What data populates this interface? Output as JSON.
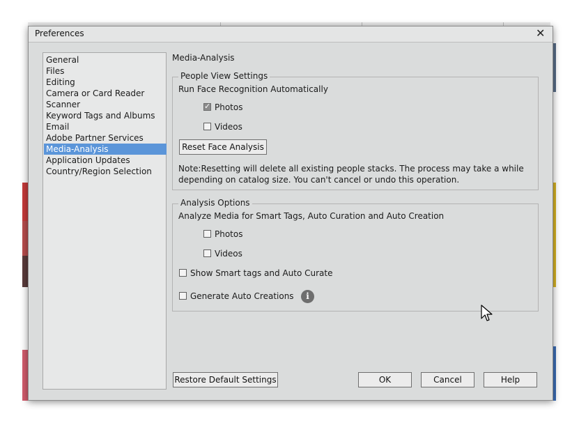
{
  "dialog": {
    "title": "Preferences",
    "close_icon": "close-icon"
  },
  "nav": {
    "items": [
      {
        "label": "General",
        "selected": false
      },
      {
        "label": "Files",
        "selected": false
      },
      {
        "label": "Editing",
        "selected": false
      },
      {
        "label": "Camera or Card Reader",
        "selected": false
      },
      {
        "label": "Scanner",
        "selected": false
      },
      {
        "label": "Keyword Tags and Albums",
        "selected": false
      },
      {
        "label": "Email",
        "selected": false
      },
      {
        "label": "Adobe Partner Services",
        "selected": false
      },
      {
        "label": "Media-Analysis",
        "selected": true
      },
      {
        "label": "Application Updates",
        "selected": false
      },
      {
        "label": "Country/Region Selection",
        "selected": false
      }
    ]
  },
  "panel": {
    "section_title": "Media-Analysis",
    "people": {
      "legend": "People View Settings",
      "heading": "Run Face Recognition Automatically",
      "photos_label": "Photos",
      "photos_checked": true,
      "videos_label": "Videos",
      "videos_checked": false,
      "reset_button": "Reset Face Analysis",
      "note_line1": "Note:Resetting will delete all existing people stacks. The process may take a while",
      "note_line2": "depending on catalog size. You can't cancel or undo this operation."
    },
    "analysis": {
      "legend": "Analysis Options",
      "heading": "Analyze Media for Smart Tags, Auto Curation and Auto Creation",
      "photos_label": "Photos",
      "photos_checked": false,
      "videos_label": "Videos",
      "videos_checked": false,
      "smart_tags_label": "Show Smart tags and Auto Curate",
      "smart_tags_checked": false,
      "auto_creations_label": "Generate Auto Creations",
      "auto_creations_checked": false,
      "info_icon": "info-icon"
    }
  },
  "footer": {
    "restore_button": "Restore Default Settings",
    "ok_button": "OK",
    "cancel_button": "Cancel",
    "help_button": "Help"
  },
  "colors": {
    "dialog_bg": "#dadcdc",
    "selection": "#5b95d9"
  }
}
